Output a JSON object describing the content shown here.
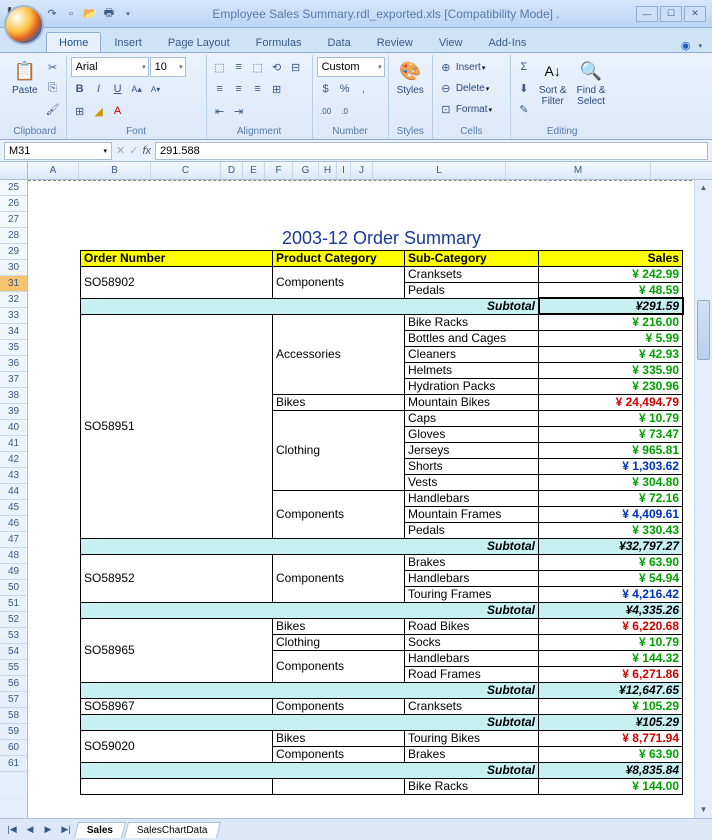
{
  "title": "Employee Sales Summary.rdl_exported.xls  [Compatibility Mode] .",
  "tabs": [
    "Home",
    "Insert",
    "Page Layout",
    "Formulas",
    "Data",
    "Review",
    "View",
    "Add-Ins"
  ],
  "ribbon": {
    "clipboard": {
      "label": "Clipboard",
      "paste": "Paste"
    },
    "font": {
      "label": "Font",
      "name": "Arial",
      "size": "10"
    },
    "alignment": {
      "label": "Alignment"
    },
    "number": {
      "label": "Number",
      "format": "Custom"
    },
    "styles": {
      "label": "Styles",
      "btn": "Styles"
    },
    "cells": {
      "label": "Cells",
      "insert": "Insert",
      "delete": "Delete",
      "format": "Format"
    },
    "editing": {
      "label": "Editing",
      "sort": "Sort &\nFilter",
      "find": "Find &\nSelect"
    }
  },
  "namebox": "M31",
  "formula": "291.588",
  "columns": [
    "A",
    "B",
    "C",
    "D",
    "E",
    "F",
    "G",
    "H",
    "I",
    "J",
    "L",
    "M"
  ],
  "rows_start": 25,
  "rows_end": 61,
  "selected_row": 31,
  "report_title": "2003-12 Order Summary",
  "headers": {
    "order": "Order Number",
    "cat": "Product Category",
    "sub": "Sub-Category",
    "sales": "Sales"
  },
  "subtotal_label": "Subtotal",
  "data": [
    {
      "order": "SO58902",
      "groups": [
        {
          "cat": "Components",
          "rows": [
            [
              "Cranksets",
              "¥ 242.99",
              "green"
            ],
            [
              "Pedals",
              "¥ 48.59",
              "green"
            ]
          ]
        }
      ],
      "subtotal": "¥291.59",
      "sel": true
    },
    {
      "order": "SO58951",
      "groups": [
        {
          "cat": "Accessories",
          "rows": [
            [
              "Bike Racks",
              "¥ 216.00",
              "green"
            ],
            [
              "Bottles and Cages",
              "¥ 5.99",
              "green"
            ],
            [
              "Cleaners",
              "¥ 42.93",
              "green"
            ],
            [
              "Helmets",
              "¥ 335.90",
              "green"
            ],
            [
              "Hydration Packs",
              "¥ 230.96",
              "green"
            ]
          ]
        },
        {
          "cat": "Bikes",
          "rows": [
            [
              "Mountain Bikes",
              "¥ 24,494.79",
              "red"
            ]
          ]
        },
        {
          "cat": "Clothing",
          "rows": [
            [
              "Caps",
              "¥ 10.79",
              "green"
            ],
            [
              "Gloves",
              "¥ 73.47",
              "green"
            ],
            [
              "Jerseys",
              "¥ 965.81",
              "green"
            ],
            [
              "Shorts",
              "¥ 1,303.62",
              "blue"
            ],
            [
              "Vests",
              "¥ 304.80",
              "green"
            ]
          ]
        },
        {
          "cat": "Components",
          "rows": [
            [
              "Handlebars",
              "¥ 72.16",
              "green"
            ],
            [
              "Mountain Frames",
              "¥ 4,409.61",
              "blue"
            ],
            [
              "Pedals",
              "¥ 330.43",
              "green"
            ]
          ]
        }
      ],
      "subtotal": "¥32,797.27"
    },
    {
      "order": "SO58952",
      "groups": [
        {
          "cat": "Components",
          "rows": [
            [
              "Brakes",
              "¥ 63.90",
              "green"
            ],
            [
              "Handlebars",
              "¥ 54.94",
              "green"
            ],
            [
              "Touring Frames",
              "¥ 4,216.42",
              "blue"
            ]
          ]
        }
      ],
      "subtotal": "¥4,335.26"
    },
    {
      "order": "SO58965",
      "groups": [
        {
          "cat": "Bikes",
          "rows": [
            [
              "Road Bikes",
              "¥ 6,220.68",
              "red"
            ]
          ]
        },
        {
          "cat": "Clothing",
          "rows": [
            [
              "Socks",
              "¥ 10.79",
              "green"
            ]
          ]
        },
        {
          "cat": "Components",
          "rows": [
            [
              "Handlebars",
              "¥ 144.32",
              "green"
            ],
            [
              "Road Frames",
              "¥ 6,271.86",
              "red"
            ]
          ]
        }
      ],
      "subtotal": "¥12,647.65"
    },
    {
      "order": "SO58967",
      "groups": [
        {
          "cat": "Components",
          "rows": [
            [
              "Cranksets",
              "¥ 105.29",
              "green"
            ]
          ]
        }
      ],
      "subtotal": "¥105.29"
    },
    {
      "order": "SO59020",
      "groups": [
        {
          "cat": "Bikes",
          "rows": [
            [
              "Touring Bikes",
              "¥ 8,771.94",
              "red"
            ]
          ]
        },
        {
          "cat": "Components",
          "rows": [
            [
              "Brakes",
              "¥ 63.90",
              "green"
            ]
          ]
        }
      ],
      "subtotal": "¥8,835.84"
    },
    {
      "order": "",
      "groups": [
        {
          "cat": "",
          "rows": [
            [
              "Bike Racks",
              "¥ 144.00",
              "green"
            ]
          ]
        }
      ]
    }
  ],
  "sheets": [
    "Sales",
    "SalesChartData"
  ]
}
